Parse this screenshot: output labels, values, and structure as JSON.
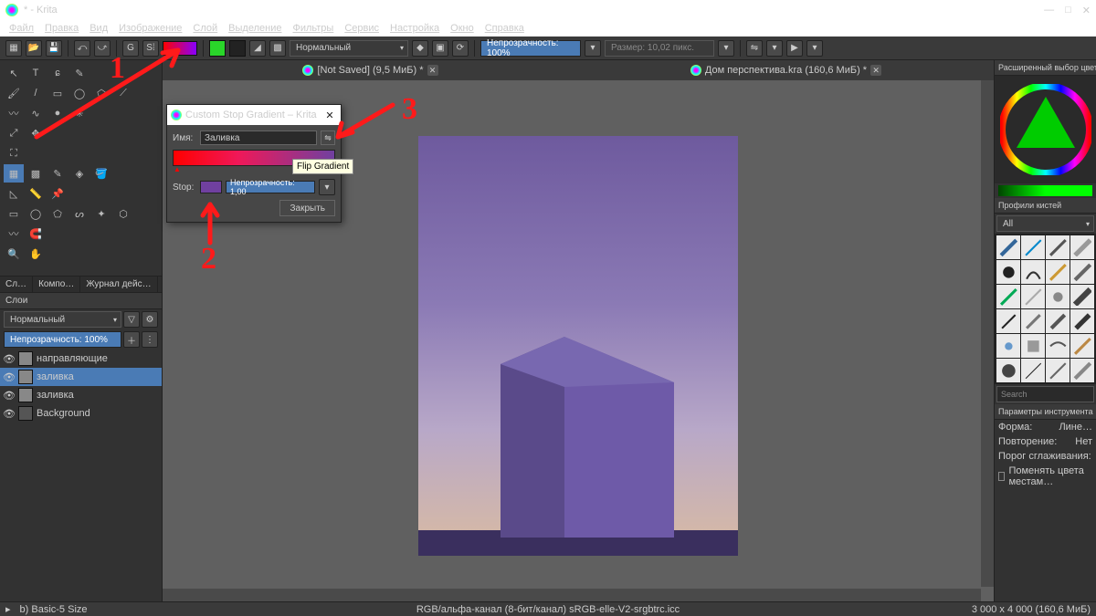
{
  "window": {
    "title": "* - Krita",
    "buttons": {
      "min": "—",
      "max": "□",
      "close": "✕"
    }
  },
  "menus": [
    "Файл",
    "Правка",
    "Вид",
    "Изображение",
    "Слой",
    "Выделение",
    "Фильтры",
    "Сервис",
    "Настройка",
    "Окно",
    "Справка"
  ],
  "toolbar": {
    "blend_mode": "Нормальный",
    "opacity": "Непрозрачность: 100%",
    "size": "Размер: 10,02 пикс."
  },
  "tabs": [
    {
      "title": "[Not Saved]  (9,5 МиБ) *"
    },
    {
      "title": "Дом перспектива.kra  (160,6 МиБ) *"
    }
  ],
  "left_tabs": [
    "Сл…",
    "Компо…",
    "Журнал дейс…"
  ],
  "layers": {
    "header": "Слои",
    "blend_mode": "Нормальный",
    "opacity": "Непрозрачность:  100%",
    "list": [
      {
        "name": "направляющие",
        "selected": false
      },
      {
        "name": "заливка",
        "selected": true
      },
      {
        "name": "заливка",
        "selected": false
      },
      {
        "name": "Background",
        "selected": false
      }
    ]
  },
  "dialog": {
    "title": "Custom Stop Gradient – Krita",
    "name_label": "Имя:",
    "name_value": "Заливка",
    "stop_label": "Stop:",
    "stop_opacity": "Непрозрачность: 1,00",
    "close": "Закрыть",
    "tooltip": "Flip Gradient"
  },
  "right": {
    "color_header": "Расширенный выбор цвета",
    "brush_header": "Профили кистей",
    "brush_filter": "All",
    "search": "Search",
    "tool_header": "Параметры инструмента",
    "shape_label": "Форма:",
    "shape_value": "Лине…",
    "repeat_label": "Повторение:",
    "repeat_value": "Нет",
    "aa_label": "Порог сглаживания:",
    "swap_label": "Поменять цвета местам…"
  },
  "status": {
    "left": "b)  Basic-5 Size",
    "center": "RGB/альфа-канал (8-бит/канал)  sRGB-elle-V2-srgbtrc.icc",
    "right": "3 000 x 4 000 (160,6 МиБ)"
  },
  "annotations": {
    "a1": "1",
    "a2": "2",
    "a3": "3"
  }
}
